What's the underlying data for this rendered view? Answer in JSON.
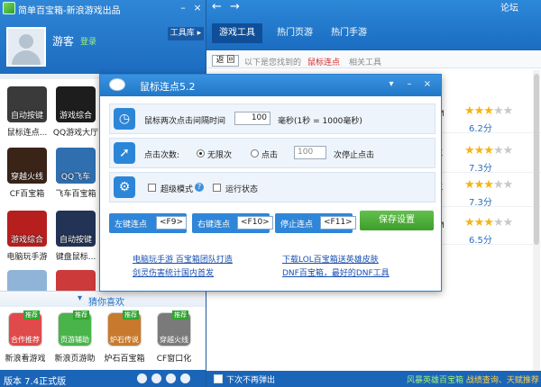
{
  "app": {
    "title": "简单百宝箱-新浪游戏出品",
    "username": "游客",
    "login": "登录",
    "toolbox_tab": "工具库",
    "version": "版本 7.4正式版"
  },
  "apps": [
    {
      "label": "鼠标连点...",
      "icon_text": "自动按键",
      "color": "#3a3a3a"
    },
    {
      "label": "QQ游戏大厅",
      "icon_text": "游戏综合",
      "color": "#1d1d1d"
    },
    {
      "label": "CF百宝箱",
      "icon_text": "穿越火线",
      "color": "#3a2418"
    },
    {
      "label": "飞车百宝箱",
      "icon_text": "QQ飞车",
      "color": "#2f6fb0"
    },
    {
      "label": "电脑玩手游",
      "icon_text": "游戏综合",
      "color": "#b71f1f"
    },
    {
      "label": "键盘鼠标...",
      "icon_text": "自动按键",
      "color": "#223355"
    },
    {
      "label": "",
      "icon_text": "",
      "color": "#8fb4d8"
    },
    {
      "label": "",
      "icon_text": "",
      "color": "#cc3a3a"
    }
  ],
  "guess": {
    "title": "猜你喜欢",
    "items": [
      {
        "label": "新浪看游戏",
        "icon_text": "合作推荐",
        "tag": "推荐",
        "color": "#e04a4a"
      },
      {
        "label": "新浪页游助",
        "icon_text": "页游辅助",
        "tag": "推荐",
        "color": "#49b44a"
      },
      {
        "label": "炉石百宝箱",
        "icon_text": "炉石传说",
        "tag": "推荐",
        "color": "#c77a2e"
      },
      {
        "label": "CF窗口化",
        "icon_text": "穿越火线",
        "tag": "推荐",
        "color": "#7a7a7a"
      }
    ]
  },
  "right": {
    "forum": "论坛",
    "tabs": [
      "游戏工具",
      "热门页游",
      "热门手游"
    ],
    "back": "返 回",
    "bc_prefix": "以下是您找到的",
    "bc_keyword": "鼠标连点",
    "bc_related": "相关工具",
    "results": [
      {
        "cut": "M",
        "stars": 3,
        "score": "6.2分"
      },
      {
        "cut": "K",
        "stars": 3,
        "score": "7.3分"
      },
      {
        "cut": "K",
        "stars": 3,
        "score": "7.3分"
      },
      {
        "cut": "M",
        "stars": 3,
        "score": "6.5分"
      }
    ],
    "footer_checkbox": "下次不再弹出",
    "footer_link1": "风暴英雄百宝箱",
    "footer_link2": "战绩查询、天赋推荐"
  },
  "dialog": {
    "title": "鼠标连点5.2",
    "interval_label": "鼠标两次点击间隔时间",
    "interval_value": "100",
    "interval_unit": "毫秒(1秒 = 1000毫秒)",
    "count_label": "点击次数:",
    "unlimited": "无限次",
    "limited": "点击",
    "count_value": "100",
    "count_suffix": "次停止点击",
    "super_mode": "超级模式",
    "run_state": "运行状态",
    "left_click": "左键连点",
    "left_key": "<F9>",
    "right_click": "右键连点",
    "right_key": "<F10>",
    "stop_click": "停止连点",
    "stop_key": "<F11>",
    "save": "保存设置",
    "link1": "电脑玩手游 百宝箱团队打造",
    "link2": "剑灵伤害统计国内首发",
    "link3": "下载LOL百宝箱送英雄皮肤",
    "link4": "DNF百宝箱，最好的DNF工具"
  }
}
